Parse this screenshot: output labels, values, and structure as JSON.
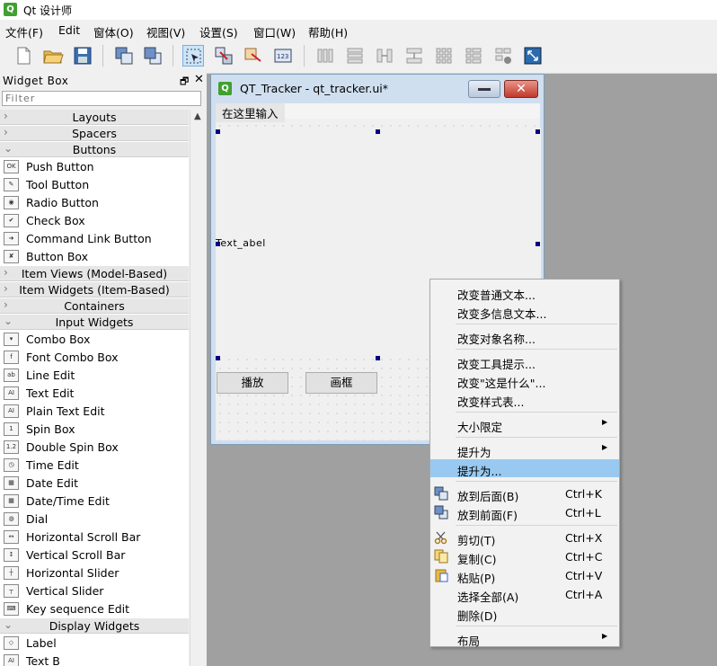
{
  "app": {
    "title": "Qt 设计师"
  },
  "menubar": [
    "文件(F)",
    "Edit",
    "窗体(O)",
    "视图(V)",
    "设置(S)",
    "窗口(W)",
    "帮助(H)"
  ],
  "toolbar": {
    "icons": [
      "new-file-icon",
      "open-folder-icon",
      "save-icon",
      "send-to-back-icon",
      "bring-to-front-icon",
      "edit-widgets-icon",
      "edit-signals-slots-icon",
      "edit-buddies-icon",
      "edit-tab-order-icon",
      "layout-horizontal-icon",
      "layout-vertical-icon",
      "layout-horizontal-splitter-icon",
      "layout-vertical-splitter-icon",
      "layout-grid-icon",
      "layout-form-icon",
      "break-layout-icon",
      "adjust-size-icon"
    ]
  },
  "widget_box": {
    "title": "Widget Box",
    "float_button": "🗗",
    "close_button": "✕",
    "filter_placeholder": "Filter",
    "tree": [
      {
        "type": "cat",
        "label": "Layouts",
        "expanded": false
      },
      {
        "type": "cat",
        "label": "Spacers",
        "expanded": false
      },
      {
        "type": "cat",
        "label": "Buttons",
        "expanded": true
      },
      {
        "type": "item",
        "label": "Push Button",
        "icon": "push-button-icon",
        "glyph": "OK"
      },
      {
        "type": "item",
        "label": "Tool Button",
        "icon": "tool-button-icon",
        "glyph": "✎"
      },
      {
        "type": "item",
        "label": "Radio Button",
        "icon": "radio-button-icon",
        "glyph": "◉"
      },
      {
        "type": "item",
        "label": "Check Box",
        "icon": "check-box-icon",
        "glyph": "✔"
      },
      {
        "type": "item",
        "label": "Command Link Button",
        "icon": "command-link-icon",
        "glyph": "➜"
      },
      {
        "type": "item",
        "label": "Button Box",
        "icon": "button-box-icon",
        "glyph": "✘"
      },
      {
        "type": "cat",
        "label": "Item Views (Model-Based)",
        "expanded": false
      },
      {
        "type": "cat",
        "label": "Item Widgets (Item-Based)",
        "expanded": false
      },
      {
        "type": "cat",
        "label": "Containers",
        "expanded": false
      },
      {
        "type": "cat",
        "label": "Input Widgets",
        "expanded": true
      },
      {
        "type": "item",
        "label": "Combo Box",
        "icon": "combo-box-icon",
        "glyph": "▾"
      },
      {
        "type": "item",
        "label": "Font Combo Box",
        "icon": "font-combo-box-icon",
        "glyph": "f"
      },
      {
        "type": "item",
        "label": "Line Edit",
        "icon": "line-edit-icon",
        "glyph": "ab"
      },
      {
        "type": "item",
        "label": "Text Edit",
        "icon": "text-edit-icon",
        "glyph": "AI"
      },
      {
        "type": "item",
        "label": "Plain Text Edit",
        "icon": "plain-text-edit-icon",
        "glyph": "AI"
      },
      {
        "type": "item",
        "label": "Spin Box",
        "icon": "spin-box-icon",
        "glyph": "1"
      },
      {
        "type": "item",
        "label": "Double Spin Box",
        "icon": "double-spin-box-icon",
        "glyph": "1.2"
      },
      {
        "type": "item",
        "label": "Time Edit",
        "icon": "time-edit-icon",
        "glyph": "◷"
      },
      {
        "type": "item",
        "label": "Date Edit",
        "icon": "date-edit-icon",
        "glyph": "▦"
      },
      {
        "type": "item",
        "label": "Date/Time Edit",
        "icon": "date-time-edit-icon",
        "glyph": "▦"
      },
      {
        "type": "item",
        "label": "Dial",
        "icon": "dial-icon",
        "glyph": "◍"
      },
      {
        "type": "item",
        "label": "Horizontal Scroll Bar",
        "icon": "horizontal-scroll-bar-icon",
        "glyph": "↔"
      },
      {
        "type": "item",
        "label": "Vertical Scroll Bar",
        "icon": "vertical-scroll-bar-icon",
        "glyph": "↕"
      },
      {
        "type": "item",
        "label": "Horizontal Slider",
        "icon": "horizontal-slider-icon",
        "glyph": "┼"
      },
      {
        "type": "item",
        "label": "Vertical Slider",
        "icon": "vertical-slider-icon",
        "glyph": "┬"
      },
      {
        "type": "item",
        "label": "Key sequence Edit",
        "icon": "key-sequence-edit-icon",
        "glyph": "⌨"
      },
      {
        "type": "cat",
        "label": "Display Widgets",
        "expanded": true
      },
      {
        "type": "item",
        "label": "Label",
        "icon": "label-icon",
        "glyph": "◇"
      },
      {
        "type": "item",
        "label": "Text B",
        "icon": "text-browser-icon",
        "glyph": "AI"
      }
    ]
  },
  "form": {
    "title": "QT_Tracker - qt_tracker.ui*",
    "menu_placeholder": "在这里输入",
    "label_text": "Text_abel",
    "buttons": [
      "播放",
      "画框"
    ]
  },
  "context_menu": {
    "items": [
      {
        "label": "改变普通文本...",
        "shortcut": "",
        "sub": false
      },
      {
        "label": "改变多信息文本...",
        "shortcut": "",
        "sub": false
      },
      {
        "sep": true
      },
      {
        "label": "改变对象名称...",
        "shortcut": "",
        "sub": false
      },
      {
        "sep": true
      },
      {
        "label": "改变工具提示...",
        "shortcut": "",
        "sub": false
      },
      {
        "label": "改变\"这是什么\"...",
        "shortcut": "",
        "sub": false
      },
      {
        "label": "改变样式表...",
        "shortcut": "",
        "sub": false
      },
      {
        "sep": true
      },
      {
        "label": "大小限定",
        "shortcut": "",
        "sub": true
      },
      {
        "sep": true
      },
      {
        "label": "提升为",
        "shortcut": "",
        "sub": true
      },
      {
        "label": "提升为...",
        "shortcut": "",
        "sub": false,
        "highlight": true
      },
      {
        "sep": true
      },
      {
        "label": "放到后面(B)",
        "shortcut": "Ctrl+K",
        "sub": false,
        "icon": "send-to-back-icon"
      },
      {
        "label": "放到前面(F)",
        "shortcut": "Ctrl+L",
        "sub": false,
        "icon": "bring-to-front-icon"
      },
      {
        "sep": true
      },
      {
        "label": "剪切(T)",
        "shortcut": "Ctrl+X",
        "sub": false,
        "icon": "cut-icon"
      },
      {
        "label": "复制(C)",
        "shortcut": "Ctrl+C",
        "sub": false,
        "icon": "copy-icon"
      },
      {
        "label": "粘贴(P)",
        "shortcut": "Ctrl+V",
        "sub": false,
        "icon": "paste-icon"
      },
      {
        "label": "选择全部(A)",
        "shortcut": "Ctrl+A",
        "sub": false
      },
      {
        "label": "删除(D)",
        "shortcut": "",
        "sub": false
      },
      {
        "sep": true
      },
      {
        "label": "布局",
        "shortcut": "",
        "sub": true
      }
    ]
  },
  "colors": {
    "highlight": "#99c9f0",
    "handle": "#000080",
    "workspace": "#a0a0a0"
  }
}
